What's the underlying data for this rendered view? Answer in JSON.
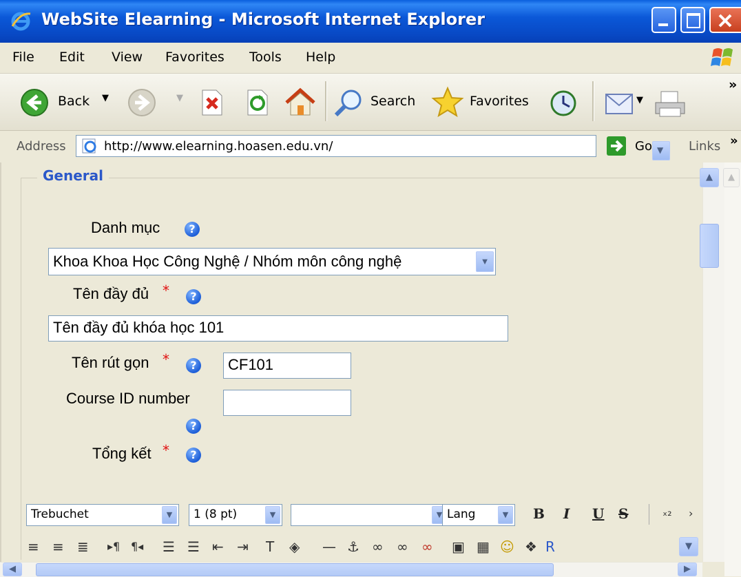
{
  "window": {
    "title": "WebSite Elearning - Microsoft Internet Explorer"
  },
  "menu": {
    "items": [
      "File",
      "Edit",
      "View",
      "Favorites",
      "Tools",
      "Help"
    ]
  },
  "toolbar": {
    "back_label": "Back",
    "search_label": "Search",
    "favorites_label": "Favorites",
    "overflow": "»"
  },
  "address": {
    "label": "Address",
    "url": "http://www.elearning.hoasen.edu.vn/",
    "go_label": "Go",
    "links_label": "Links",
    "overflow": "»"
  },
  "form": {
    "legend": "General",
    "category_label": "Danh mục",
    "category_value": "Khoa Khoa Học Công Nghệ / Nhóm môn công nghệ",
    "fullname_label": "Tên đầy đủ",
    "fullname_value": "Tên đầy đủ khóa học 101",
    "shortname_label": "Tên rút gọn",
    "shortname_value": "CF101",
    "idnumber_label": "Course ID number",
    "idnumber_value": "",
    "summary_label": "Tổng kết",
    "required_mark": "*",
    "help_mark": "?"
  },
  "editor": {
    "font_family": "Trebuchet",
    "font_size": "1 (8 pt)",
    "format": "",
    "lang": "Lang",
    "bold": "B",
    "italic": "I",
    "underline": "U",
    "strike": "S"
  },
  "colors": {
    "titlebar": "#0A5FDD",
    "legend": "#2B58C9",
    "required": "#E01010",
    "background": "#ECE9D8"
  }
}
